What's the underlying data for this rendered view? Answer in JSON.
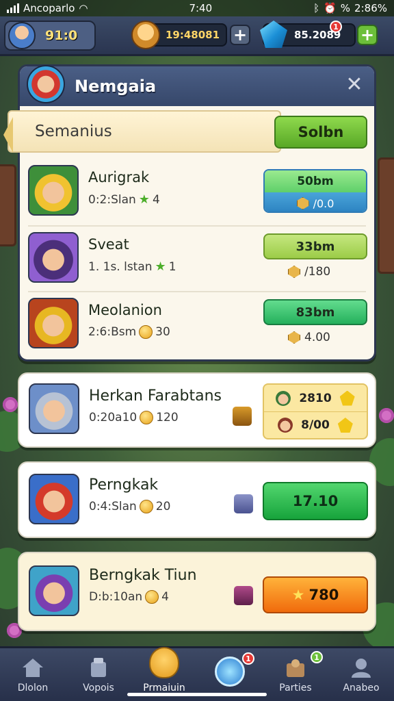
{
  "status_bar": {
    "carrier": "Ancoparlo",
    "time": "7:40",
    "battery": "2:86%",
    "battery_pct": "%"
  },
  "topbar": {
    "player_level": "91:0",
    "coins": "19:48081",
    "gems": "85.2089",
    "gems_badge": "1"
  },
  "panel": {
    "title": "Nemgaia",
    "section_label": "Semanius",
    "section_button": "Solbn",
    "rows": [
      {
        "name": "Aurigrak",
        "sub": "0:2:Slan",
        "sub_value": "4",
        "pill": "50bm",
        "pill_sub": "/0.0"
      },
      {
        "name": "Sveat",
        "sub": "1. 1s. lstan",
        "sub_value": "1",
        "pill": "33bm",
        "cost": "/180"
      },
      {
        "name": "Meolanion",
        "sub": "2:6:Bsm",
        "sub_value": "30",
        "pill": "83bm",
        "cost": "4.00"
      }
    ]
  },
  "cards": [
    {
      "name": "Herkan Farabtans",
      "sub": "0:20a10",
      "sub_value": "120",
      "top_value": "2810",
      "bottom_value": "8/00"
    },
    {
      "name": "Perngkak",
      "sub": "0:4:Slan",
      "sub_value": "20",
      "button": "17.10"
    },
    {
      "name": "Berngkak Tiun",
      "sub": "D:b:10an",
      "sub_value": "4",
      "button": "780"
    }
  ],
  "nav": {
    "items": [
      {
        "label": "Dlolon",
        "icon": "home-icon"
      },
      {
        "label": "Vopois",
        "icon": "shop-icon"
      },
      {
        "label": "Prmaiuin",
        "icon": "trophy-icon"
      },
      {
        "label": "",
        "icon": "mail-icon",
        "badge": "1"
      },
      {
        "label": "Parties",
        "icon": "party-icon",
        "badge": "1"
      },
      {
        "label": "Anabeo",
        "icon": "profile-icon"
      }
    ]
  },
  "colors": {
    "accent_green": "#24b05c",
    "accent_orange": "#f06b0c",
    "panel_header": "#36476a",
    "badge_red": "#e53935"
  }
}
